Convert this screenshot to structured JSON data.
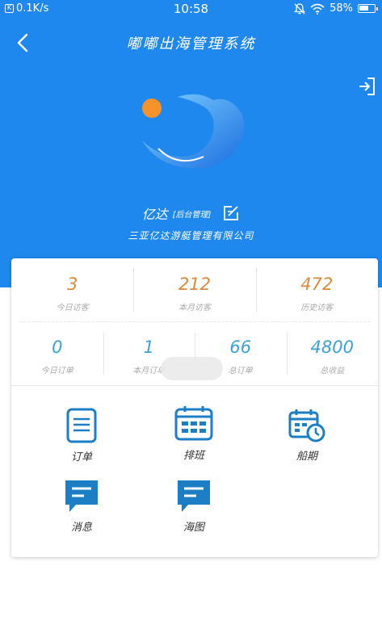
{
  "status_bar": {
    "network_speed": "0.1K/s",
    "time": "10:58",
    "battery": "58%"
  },
  "nav": {
    "title": "嘟嘟出海管理系统",
    "back_icon": "chevron-left-icon",
    "logout_icon": "logout-icon"
  },
  "profile": {
    "name": "亿达",
    "role": "[后台管理]",
    "company": "三亚亿达游艇管理有限公司",
    "edit_icon": "edit-icon"
  },
  "stats_top": [
    {
      "value": "3",
      "label": "今日访客"
    },
    {
      "value": "212",
      "label": "本月访客"
    },
    {
      "value": "472",
      "label": "历史访客"
    }
  ],
  "stats_bottom": [
    {
      "value": "0",
      "label": "今日订单"
    },
    {
      "value": "1",
      "label": "本月订单"
    },
    {
      "value": "66",
      "label": "总订单"
    },
    {
      "value": "4800",
      "label": "总收益"
    }
  ],
  "menu": [
    {
      "label": "订单",
      "icon": "document-icon"
    },
    {
      "label": "排班",
      "icon": "calendar-icon"
    },
    {
      "label": "船期",
      "icon": "calendar-clock-icon"
    },
    {
      "label": "消息",
      "icon": "chat-icon"
    },
    {
      "label": "海图",
      "icon": "chat-icon"
    }
  ],
  "colors": {
    "header_blue": "#1e88ee",
    "accent_orange": "#d98a3a",
    "accent_blue": "#3aa2d6",
    "icon_blue": "#1c7fc6"
  }
}
